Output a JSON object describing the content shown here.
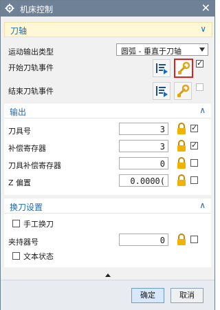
{
  "window": {
    "title": "机床控制",
    "close_icon": "close-icon"
  },
  "section_tool_axis": {
    "title": "刀轴",
    "motion_output_label": "运动输出类型",
    "motion_output_value": "圆弧 - 垂直于刀轴",
    "start_event_label": "开始刀轨事件",
    "end_event_label": "结束刀轨事件",
    "start_event_checked": true,
    "end_event_checked": false
  },
  "section_output": {
    "title": "输出",
    "rows": [
      {
        "label": "刀具号",
        "value": "3",
        "checked": true
      },
      {
        "label": "补偿寄存器",
        "value": "3",
        "checked": true
      },
      {
        "label": "刀具补偿寄存器",
        "value": "0",
        "checked": false
      },
      {
        "label": "Z 偏置",
        "value": "0.0000(",
        "checked": false
      }
    ]
  },
  "section_tool_change": {
    "title": "换刀设置",
    "manual_change_label": "手工换刀",
    "holder_label": "夹持器号",
    "holder_value": "0",
    "text_status_label": "文本状态"
  },
  "footer": {
    "ok": "确定",
    "cancel": "取消"
  },
  "colors": {
    "titlebar": "#6f8196",
    "accent": "#1a6bb5",
    "highlight": "#e02020"
  }
}
